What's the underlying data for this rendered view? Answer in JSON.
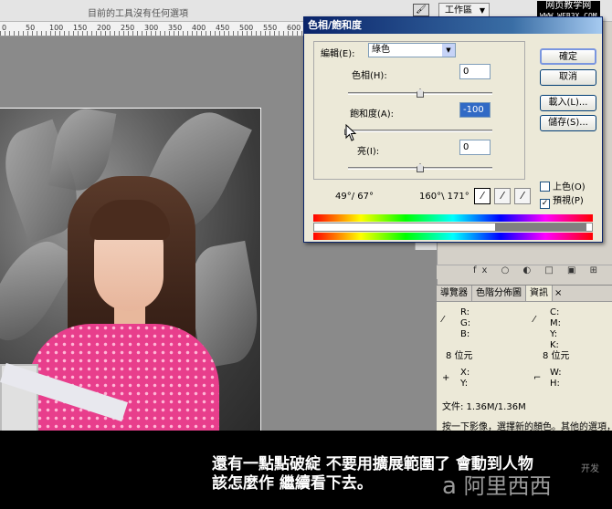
{
  "options_bar": {
    "hint": "目前的工具沒有任何選項",
    "workspace_label": "工作區",
    "workspace_caret": "▼",
    "tool_icon": "🖌"
  },
  "site_tag": {
    "line1": "网页教学网",
    "line2": "WWW.WEB3X.COM"
  },
  "ruler": {
    "ticks": [
      "0",
      "50",
      "100",
      "150",
      "200",
      "250",
      "300",
      "350",
      "400",
      "450",
      "500",
      "550",
      "600"
    ]
  },
  "dialog": {
    "title": "色相/飽和度",
    "edit_label": "編輯(E):",
    "edit_value": "綠色",
    "hue_label": "色相(H):",
    "hue_value": "0",
    "saturation_label": "飽和度(A):",
    "saturation_value": "-100",
    "lightness_label": "亮(I):",
    "lightness_value": "0",
    "buttons": {
      "ok": "確定",
      "cancel": "取消",
      "load": "載入(L)...",
      "save": "儲存(S)..."
    },
    "colorize_label": "上色(O)",
    "preview_label": "預視(P)",
    "range_left": "49°/ 67°",
    "range_right": "160°\\ 171°",
    "eyedroppers": [
      "eyedropper-icon",
      "eyedropper-plus-icon",
      "eyedropper-minus-icon"
    ],
    "colorize_checked": false,
    "preview_checked": true,
    "hue_level": 0,
    "saturation_level": -100,
    "lightness_level": 0
  },
  "layers": {
    "icons": "fx ○ ◐ □ ▣ ⊞"
  },
  "info_panel": {
    "tabs": [
      "導覽器",
      "色階分佈圖",
      "資訊"
    ],
    "tab_close": "×",
    "rgb": [
      "R:",
      "G:",
      "B:"
    ],
    "cmyk": [
      "C:",
      "M:",
      "Y:",
      "K:"
    ],
    "bits_left": "8 位元",
    "bits_right": "8 位元",
    "xy": [
      "X:",
      "Y:"
    ],
    "wh": [
      "W:",
      "H:"
    ],
    "file_size": "文件: 1.36M/1.36M",
    "help_text": "按一下影像，選擇新的顏色。其他的選項，"
  },
  "caption": {
    "line1": "還有一點點破綻 不要用擴展範圍了 會動到人物",
    "line2": "該怎麼作 繼續看下去。"
  },
  "watermark": {
    "logo_mark": "a",
    "logo_text": "阿里西西",
    "small": "开发"
  }
}
